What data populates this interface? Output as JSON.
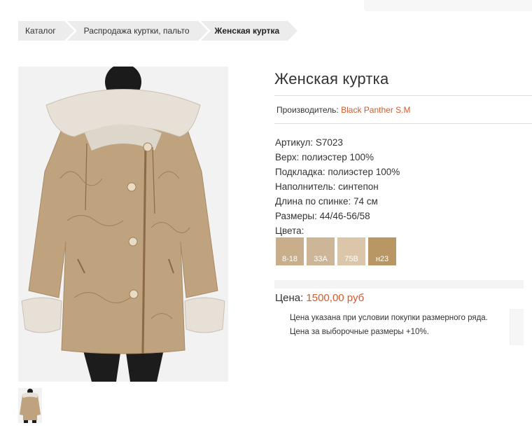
{
  "breadcrumb": [
    {
      "label": "Каталог"
    },
    {
      "label": "Распродажа куртки, пальто"
    },
    {
      "label": "Женская куртка"
    }
  ],
  "product": {
    "title": "Женская куртка",
    "manufacturer_label": "Производитель:",
    "manufacturer_value": "Black Panther S.M",
    "specs": [
      "Артикул: S7023",
      "Верх: полиэстер 100%",
      "Подкладка: полиэстер 100%",
      "Наполнитель: синтепон",
      "Длина по спинке: 74 см",
      "Размеры: 44/46-56/58",
      "Цвета:"
    ],
    "colors": [
      {
        "code": "8-18",
        "hex": "#c9ae8c"
      },
      {
        "code": "33А",
        "hex": "#cdb597"
      },
      {
        "code": "75В",
        "hex": "#dcc6a9"
      },
      {
        "code": "н23",
        "hex": "#b89764"
      }
    ],
    "price_label": "Цена:",
    "price_value": "1500,00 руб",
    "notes": [
      "Цена указана при условии покупки размерного ряда.",
      "Цена за выборочные размеры +10%."
    ]
  },
  "theme": {
    "accent": "#d65a2a",
    "jacket": "#bfa27e",
    "fur": "#e6e0d6"
  }
}
